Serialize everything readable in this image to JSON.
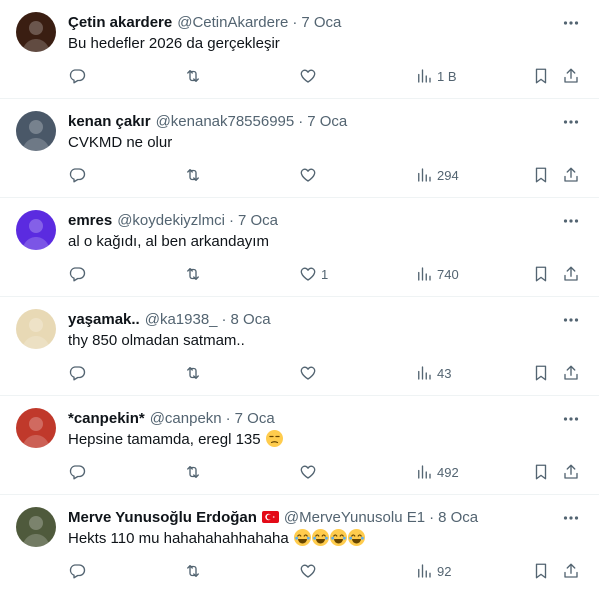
{
  "tweets": [
    {
      "name": "Çetin akardere",
      "handle": "@CetinAkardere",
      "sep": "·",
      "time": "7 Oca",
      "text": "Bu hedefler 2026 da gerçekleşir",
      "likes": "",
      "views": "1 B",
      "avatar_color": "#3a1e12"
    },
    {
      "name": "kenan çakır",
      "handle": "@kenanak78556995",
      "sep": "·",
      "time": "7 Oca",
      "text": "CVKMD ne olur",
      "likes": "",
      "views": "294",
      "avatar_color": "#4a5868"
    },
    {
      "name": "emres",
      "handle": "@koydekiyzlmci",
      "sep": "·",
      "time": "7 Oca",
      "text": "al o kağıdı, al ben arkandayım",
      "likes": "1",
      "views": "740",
      "avatar_color": "#5b2be0"
    },
    {
      "name": "yaşamak..",
      "handle": "@ka1938_",
      "sep": "·",
      "time": "8 Oca",
      "text": "thy 850 olmadan satmam..",
      "likes": "",
      "views": "43",
      "avatar_color": "#e8d9b5"
    },
    {
      "name": "*canpekin*",
      "handle": "@canpekn",
      "sep": "·",
      "time": "7 Oca",
      "text": "Hepsine tamamda, eregl 135",
      "likes": "",
      "views": "492",
      "avatar_color": "#c0392b",
      "emoji": [
        "unamused-face-emoji"
      ]
    },
    {
      "name": "Merve Yunusoğlu Erdoğan",
      "handle": "@MerveYunusolu E1",
      "sep": "·",
      "time": "8 Oca",
      "text": "Hekts 110 mu hahahahahhahaha",
      "likes": "",
      "views": "92",
      "avatar_color": "#4f5a3c",
      "flag": "turkey-flag-icon",
      "emoji": [
        "tears-of-joy-emoji",
        "tears-of-joy-emoji",
        "tears-of-joy-emoji",
        "tears-of-joy-emoji"
      ]
    }
  ],
  "colors": {
    "text": "#0f1419",
    "secondary": "#536471",
    "divider": "#eff3f4",
    "emoji": "#ffcc4d"
  }
}
